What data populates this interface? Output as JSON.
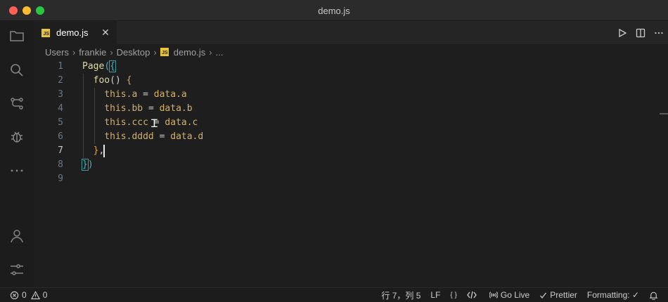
{
  "window": {
    "title": "demo.js"
  },
  "tabs": [
    {
      "label": "demo.js",
      "icon": "js-file-icon",
      "close": "✕"
    }
  ],
  "breadcrumb": [
    "Users",
    "frankie",
    "Desktop",
    "demo.js",
    "..."
  ],
  "editor": {
    "active_line": 7,
    "lines": [
      {
        "n": "1",
        "text": "Page({"
      },
      {
        "n": "2",
        "text": "  foo() {"
      },
      {
        "n": "3",
        "text": "    this.a = data.a"
      },
      {
        "n": "4",
        "text": "    this.bb = data.b"
      },
      {
        "n": "5",
        "text": "    this.ccc = data.c"
      },
      {
        "n": "6",
        "text": "    this.dddd = data.d"
      },
      {
        "n": "7",
        "text": "  },"
      },
      {
        "n": "8",
        "text": "})"
      },
      {
        "n": "9",
        "text": ""
      }
    ]
  },
  "statusbar": {
    "errors": "0",
    "warnings": "0",
    "position": "行 7，列 5",
    "eol": "LF",
    "language_braces": "{ }",
    "go_live": "Go Live",
    "prettier": "Prettier",
    "formatting": "Formatting: ✓"
  },
  "colors": {
    "accent_js": "#e8c43a",
    "bracket": "#3fb6c8",
    "text": "#d4b06a"
  }
}
